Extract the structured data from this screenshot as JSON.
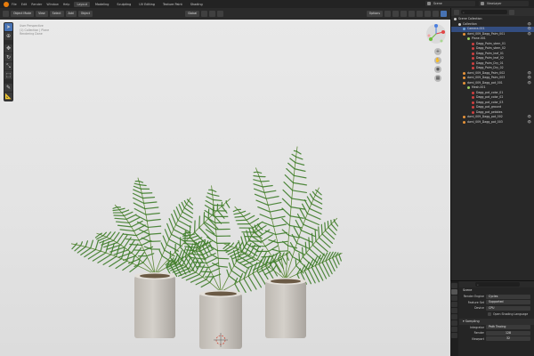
{
  "topbar": {
    "menus": [
      "File",
      "Edit",
      "Render",
      "Window",
      "Help"
    ],
    "workspaces": [
      "Layout",
      "Modeling",
      "Sculpting",
      "UV Editing",
      "Texture Paint",
      "Shading"
    ],
    "scene": "Scene",
    "view_layer": "ViewLayer"
  },
  "viewport_header": {
    "mode": "Object Mode",
    "view": "View",
    "select": "Select",
    "add": "Add",
    "object": "Object",
    "orientation": "Global",
    "options": "Options"
  },
  "viewport": {
    "info_lines": [
      "User Perspective",
      "(1) Collection | Plane",
      "Rendering Done"
    ]
  },
  "outliner": {
    "search_placeholder": "",
    "items": [
      {
        "label": "Scene Collection",
        "depth": 0,
        "icon_color": "#cccccc",
        "selected": false
      },
      {
        "label": "Collection",
        "depth": 1,
        "icon_color": "#cccccc",
        "selected": false
      },
      {
        "label": "Camera.001",
        "depth": 2,
        "icon_color": "#6fa3d6",
        "selected": true
      },
      {
        "label": "dwnl_009_Dagg_Palm_001",
        "depth": 2,
        "icon_color": "#e8943a",
        "selected": false
      },
      {
        "label": "Plane.001",
        "depth": 3,
        "icon_color": "#9ad05f",
        "selected": false
      },
      {
        "label": "Dagg_Palm_stem_01",
        "depth": 4,
        "icon_color": "#d04040",
        "selected": false
      },
      {
        "label": "Dagg_Palm_stem_02",
        "depth": 4,
        "icon_color": "#d04040",
        "selected": false
      },
      {
        "label": "Dagg_Palm_leaf_01",
        "depth": 4,
        "icon_color": "#d04040",
        "selected": false
      },
      {
        "label": "Dagg_Palm_leaf_02",
        "depth": 4,
        "icon_color": "#d04040",
        "selected": false
      },
      {
        "label": "Dagg_Palm_Dry_01",
        "depth": 4,
        "icon_color": "#d04040",
        "selected": false
      },
      {
        "label": "Dagg_Palm_Dry_02",
        "depth": 4,
        "icon_color": "#d04040",
        "selected": false
      },
      {
        "label": "dwnl_009_Dagg_Palm_002",
        "depth": 2,
        "icon_color": "#e8943a",
        "selected": false
      },
      {
        "label": "dwnl_009_Dagg_Palm_003",
        "depth": 2,
        "icon_color": "#e8943a",
        "selected": false
      },
      {
        "label": "dwnl_009_Dagg_pot_001",
        "depth": 2,
        "icon_color": "#e8943a",
        "selected": false
      },
      {
        "label": "Mesh.001",
        "depth": 3,
        "icon_color": "#9ad05f",
        "selected": false
      },
      {
        "label": "Dagg_pot_color_01",
        "depth": 4,
        "icon_color": "#d04040",
        "selected": false
      },
      {
        "label": "Dagg_pot_color_02",
        "depth": 4,
        "icon_color": "#d04040",
        "selected": false
      },
      {
        "label": "Dagg_pot_color_03",
        "depth": 4,
        "icon_color": "#d04040",
        "selected": false
      },
      {
        "label": "Dagg_pot_ground",
        "depth": 4,
        "icon_color": "#d04040",
        "selected": false
      },
      {
        "label": "Dagg_pot_pebbles",
        "depth": 4,
        "icon_color": "#d04040",
        "selected": false
      },
      {
        "label": "dwnl_009_Dagg_pot_002",
        "depth": 2,
        "icon_color": "#e8943a",
        "selected": false
      },
      {
        "label": "dwnl_009_Dagg_pot_003",
        "depth": 2,
        "icon_color": "#e8943a",
        "selected": false
      }
    ]
  },
  "properties": {
    "scene_name": "Scene",
    "render_engine_label": "Render Engine",
    "render_engine": "Cycles",
    "feature_set_label": "Feature Set",
    "feature_set": "Supported",
    "device_label": "Device",
    "device": "CPU",
    "osl_label": "Open Shading Language",
    "sampling_title": "Sampling",
    "integrator_label": "Integrator",
    "integrator": "Path Tracing",
    "render_label": "Render",
    "render_samples": "128",
    "viewport_label": "Viewport",
    "viewport_samples": "32"
  },
  "colors": {
    "accent": "#4772b3",
    "selection": "#334d80",
    "leaf": "#3e7d2a",
    "pot": "#c9c4bd"
  }
}
